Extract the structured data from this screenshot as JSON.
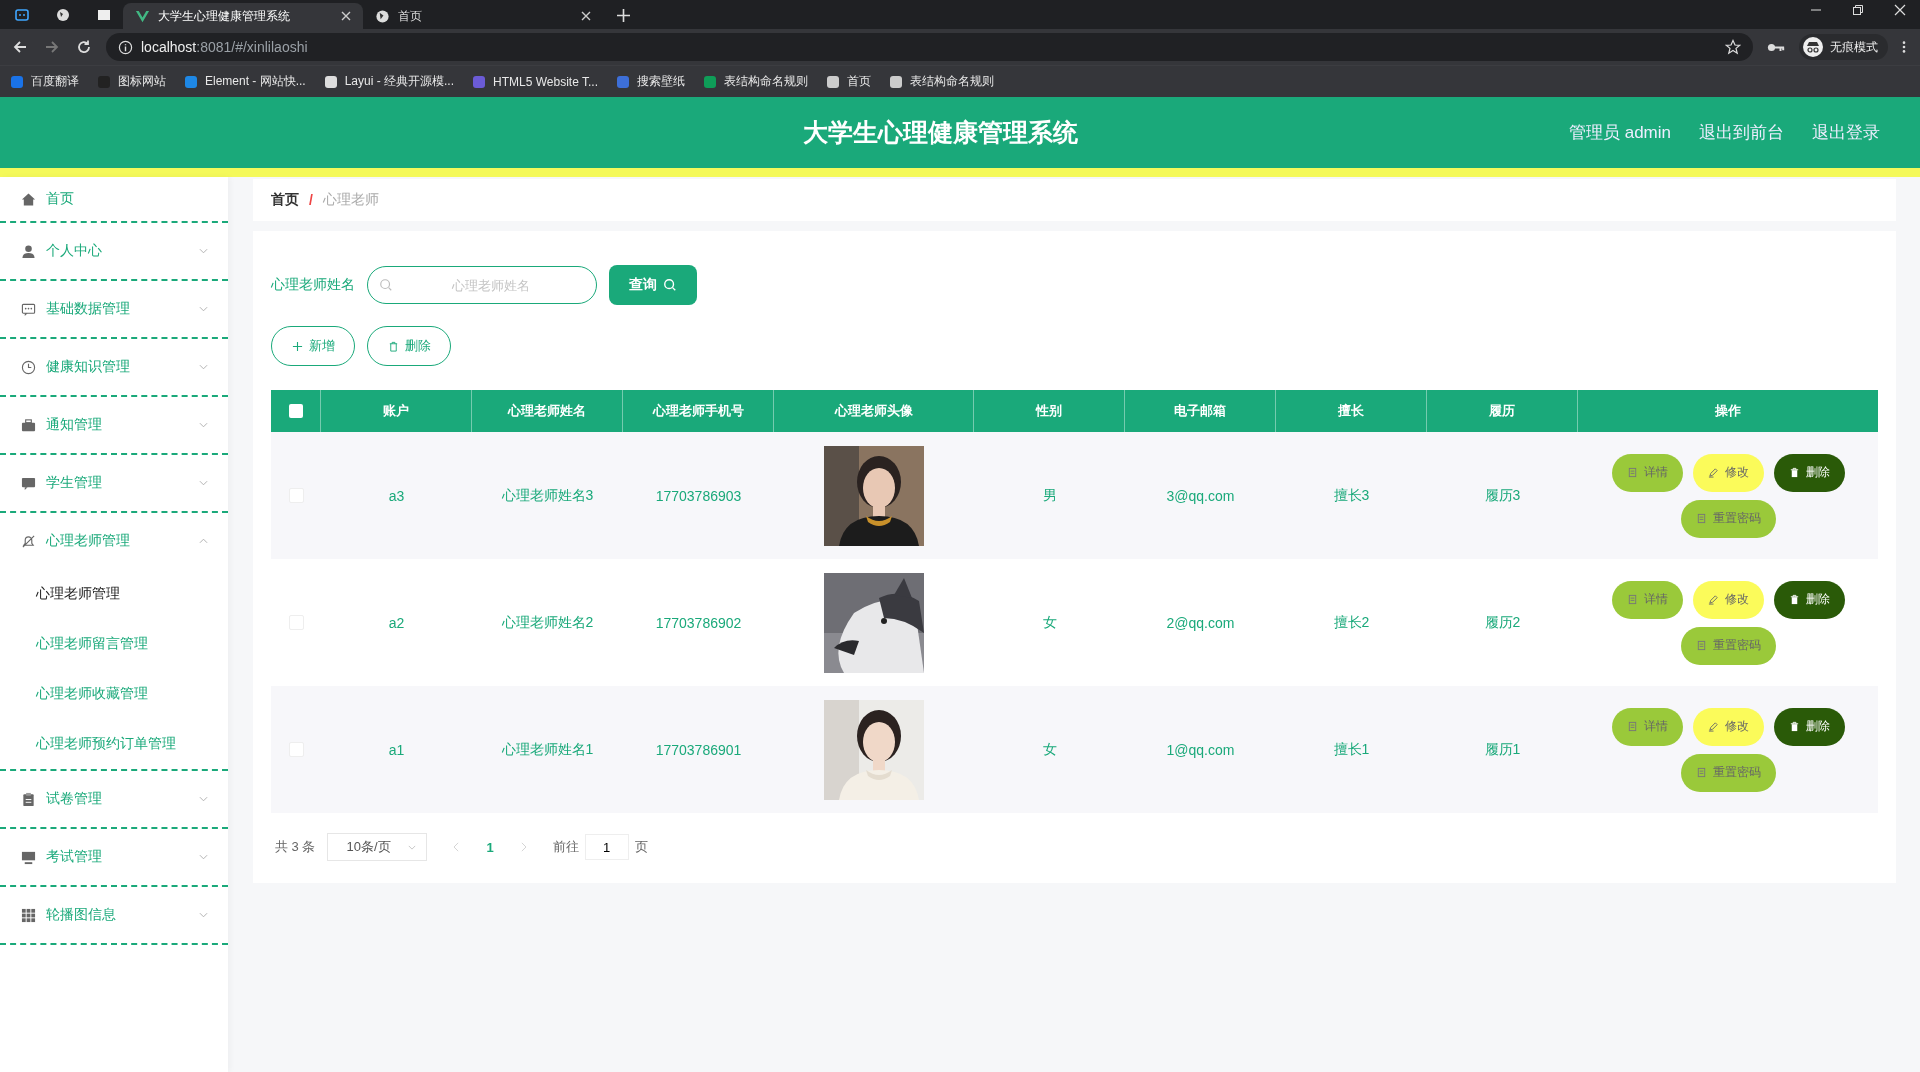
{
  "browser": {
    "tabs": [
      {
        "title": "大学生心理健康管理系统",
        "selected": true
      },
      {
        "title": "首页",
        "selected": false
      }
    ],
    "url_host": "localhost",
    "url_rest": ":8081/#/xinlilaoshi",
    "bookmarks": [
      "百度翻译",
      "图标网站",
      "Element - 网站快...",
      "Layui - 经典开源模...",
      "HTML5 Website T...",
      "搜索壁纸",
      "表结构命名规则",
      "首页",
      "表结构命名规则"
    ],
    "profile": "无痕模式"
  },
  "header": {
    "title": "大学生心理健康管理系统",
    "links": [
      "管理员 admin",
      "退出到前台",
      "退出登录"
    ]
  },
  "sidebar": {
    "items": [
      {
        "label": "首页",
        "kind": "link"
      },
      {
        "label": "个人中心",
        "kind": "menu",
        "expanded": false
      },
      {
        "label": "基础数据管理",
        "kind": "menu",
        "expanded": false
      },
      {
        "label": "健康知识管理",
        "kind": "menu",
        "expanded": false
      },
      {
        "label": "通知管理",
        "kind": "menu",
        "expanded": false
      },
      {
        "label": "学生管理",
        "kind": "menu",
        "expanded": false
      },
      {
        "label": "心理老师管理",
        "kind": "menu",
        "expanded": true,
        "children": [
          {
            "label": "心理老师管理",
            "selected": true
          },
          {
            "label": "心理老师留言管理",
            "selected": false
          },
          {
            "label": "心理老师收藏管理",
            "selected": false
          },
          {
            "label": "心理老师预约订单管理",
            "selected": false
          }
        ]
      },
      {
        "label": "试卷管理",
        "kind": "menu",
        "expanded": false
      },
      {
        "label": "考试管理",
        "kind": "menu",
        "expanded": false
      },
      {
        "label": "轮播图信息",
        "kind": "menu",
        "expanded": false
      }
    ]
  },
  "breadcrumb": {
    "separator": "/",
    "items": [
      "首页",
      "心理老师"
    ]
  },
  "search": {
    "label": "心理老师姓名",
    "placeholder": "心理老师姓名",
    "button": "查询"
  },
  "toolbar": [
    "新增",
    "删除"
  ],
  "table": {
    "all_checked": false,
    "columns": [
      "账户",
      "心理老师姓名",
      "心理老师手机号",
      "心理老师头像",
      "性别",
      "电子邮箱",
      "擅长",
      "履历",
      "操作"
    ],
    "rows": [
      {
        "checked": false,
        "account": "a3",
        "name": "心理老师姓名3",
        "phone": "17703786903",
        "gender": "男",
        "email": "3@qq.com",
        "specialty": "擅长3",
        "resume": "履历3",
        "actions": [
          "详情",
          "修改",
          "删除",
          "重置密码"
        ]
      },
      {
        "checked": false,
        "account": "a2",
        "name": "心理老师姓名2",
        "phone": "17703786902",
        "gender": "女",
        "email": "2@qq.com",
        "specialty": "擅长2",
        "resume": "履历2",
        "actions": [
          "详情",
          "修改",
          "删除",
          "重置密码"
        ]
      },
      {
        "checked": false,
        "account": "a1",
        "name": "心理老师姓名1",
        "phone": "17703786901",
        "gender": "女",
        "email": "1@qq.com",
        "specialty": "擅长1",
        "resume": "履历1",
        "actions": [
          "详情",
          "修改",
          "删除",
          "重置密码"
        ]
      }
    ]
  },
  "pagination": {
    "total": "共 3 条",
    "page_size": "10条/页",
    "pages": [
      {
        "label": "1",
        "selected": true
      }
    ],
    "goto": "前往",
    "goto_value": "1",
    "goto_unit": "页"
  }
}
